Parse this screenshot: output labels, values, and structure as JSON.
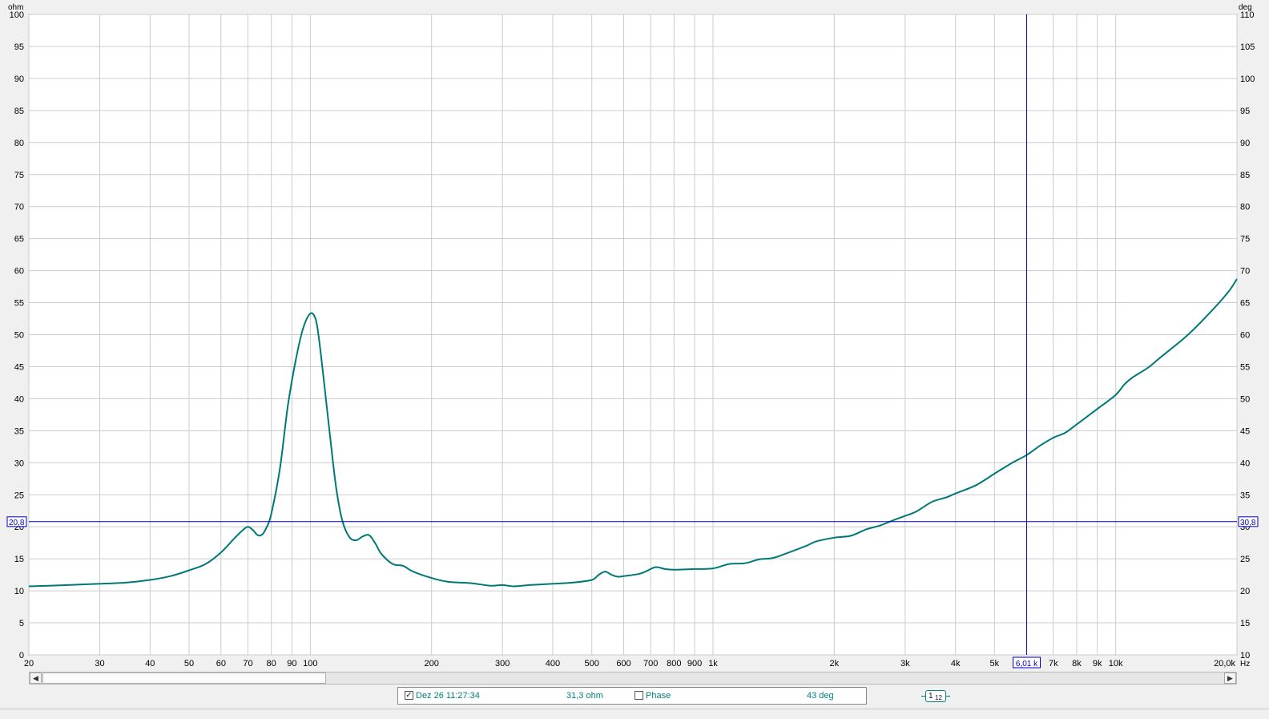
{
  "chart_data": {
    "type": "line",
    "x_scale": "log",
    "xlim": [
      20,
      20000
    ],
    "ylim": [
      0,
      100
    ],
    "y2lim": [
      10,
      110
    ],
    "y_unit": "ohm",
    "y2_unit": "deg",
    "x_unit": "Hz",
    "x_ticks": [
      20,
      30,
      40,
      50,
      60,
      70,
      80,
      90,
      100,
      200,
      300,
      400,
      500,
      600,
      700,
      800,
      900,
      1000,
      2000,
      3000,
      4000,
      5000,
      7000,
      8000,
      9000,
      10000,
      20000
    ],
    "x_tick_labels": [
      "20",
      "30",
      "40",
      "50",
      "60",
      "70",
      "80",
      "90",
      "100",
      "200",
      "300",
      "400",
      "500",
      "600",
      "700",
      "800",
      "900",
      "1k",
      "2k",
      "3k",
      "4k",
      "5k",
      "7k",
      "8k",
      "9k",
      "10k",
      "20,0k"
    ],
    "y_ticks": [
      0,
      5,
      10,
      15,
      20,
      25,
      30,
      35,
      40,
      45,
      50,
      55,
      60,
      65,
      70,
      75,
      80,
      85,
      90,
      95,
      100
    ],
    "y_tick_labels": [
      "0",
      "5",
      "10",
      "15",
      "20",
      "25",
      "30",
      "35",
      "40",
      "45",
      "50",
      "55",
      "60",
      "65",
      "70",
      "75",
      "80",
      "85",
      "90",
      "95",
      "100"
    ],
    "y2_tick_labels": [
      "10",
      "15",
      "20",
      "25",
      "30",
      "35",
      "40",
      "45",
      "50",
      "55",
      "60",
      "65",
      "70",
      "75",
      "80",
      "85",
      "90",
      "95",
      "100",
      "105",
      "110"
    ],
    "grid": true,
    "series": [
      {
        "color": "#007878",
        "x": [
          20,
          25,
          30,
          35,
          40,
          45,
          50,
          55,
          60,
          65,
          68,
          70,
          72,
          74,
          76,
          78,
          80,
          84,
          88,
          92,
          96,
          100,
          103,
          105,
          108,
          112,
          116,
          120,
          125,
          130,
          135,
          140,
          145,
          150,
          160,
          170,
          180,
          200,
          220,
          250,
          280,
          300,
          320,
          350,
          400,
          450,
          500,
          520,
          540,
          560,
          580,
          600,
          650,
          680,
          720,
          760,
          800,
          900,
          1000,
          1100,
          1200,
          1300,
          1400,
          1500,
          1700,
          1800,
          2000,
          2200,
          2400,
          2600,
          2800,
          3000,
          3200,
          3500,
          3800,
          4000,
          4500,
          5000,
          5500,
          6010,
          6500,
          7000,
          7500,
          8000,
          9000,
          10000,
          10500,
          11000,
          12000,
          13000,
          15000,
          17000,
          19000,
          20000
        ],
        "y": [
          10.7,
          10.9,
          11.1,
          11.3,
          11.7,
          12.3,
          13.2,
          14.2,
          16.0,
          18.3,
          19.5,
          20.0,
          19.5,
          18.7,
          18.8,
          20.0,
          22.0,
          29.0,
          39.0,
          46.0,
          51.0,
          53.3,
          52.5,
          49.5,
          43.0,
          34.0,
          26.0,
          21.0,
          18.4,
          17.9,
          18.5,
          18.7,
          17.4,
          15.8,
          14.2,
          13.9,
          13.0,
          12.0,
          11.4,
          11.2,
          10.8,
          10.9,
          10.7,
          10.9,
          11.1,
          11.3,
          11.7,
          12.5,
          13.0,
          12.5,
          12.2,
          12.3,
          12.6,
          13.0,
          13.7,
          13.4,
          13.3,
          13.4,
          13.5,
          14.2,
          14.3,
          14.9,
          15.1,
          15.7,
          17.0,
          17.7,
          18.3,
          18.6,
          19.6,
          20.2,
          21.0,
          21.7,
          22.4,
          23.9,
          24.6,
          25.2,
          26.5,
          28.3,
          29.9,
          31.2,
          32.7,
          33.9,
          34.7,
          36.0,
          38.4,
          40.6,
          42.2,
          43.3,
          44.8,
          46.6,
          49.8,
          53.2,
          56.6,
          58.7
        ]
      }
    ],
    "cursor_x_label": "6,01 k",
    "cursor_y_left_label": "20,8",
    "cursor_y_right_label": "30,8",
    "cursor_x_value": 6010,
    "cursor_y_value": 20.8
  },
  "legend": {
    "trace_name": "Dez 26 11:27:34",
    "trace_checked": true,
    "smoothing_num": "1",
    "smoothing_den": "12",
    "trace_value": "31,3 ohm",
    "phase_label": "Phase",
    "phase_checked": false,
    "phase_value": "43 deg"
  },
  "scrollbar": {
    "left_arrow": "◀",
    "right_arrow": "▶"
  },
  "colors": {
    "trace": "#007878",
    "cursor": "#0000c0",
    "grid": "#c8c8c8",
    "plot_bg": "#ffffff"
  }
}
